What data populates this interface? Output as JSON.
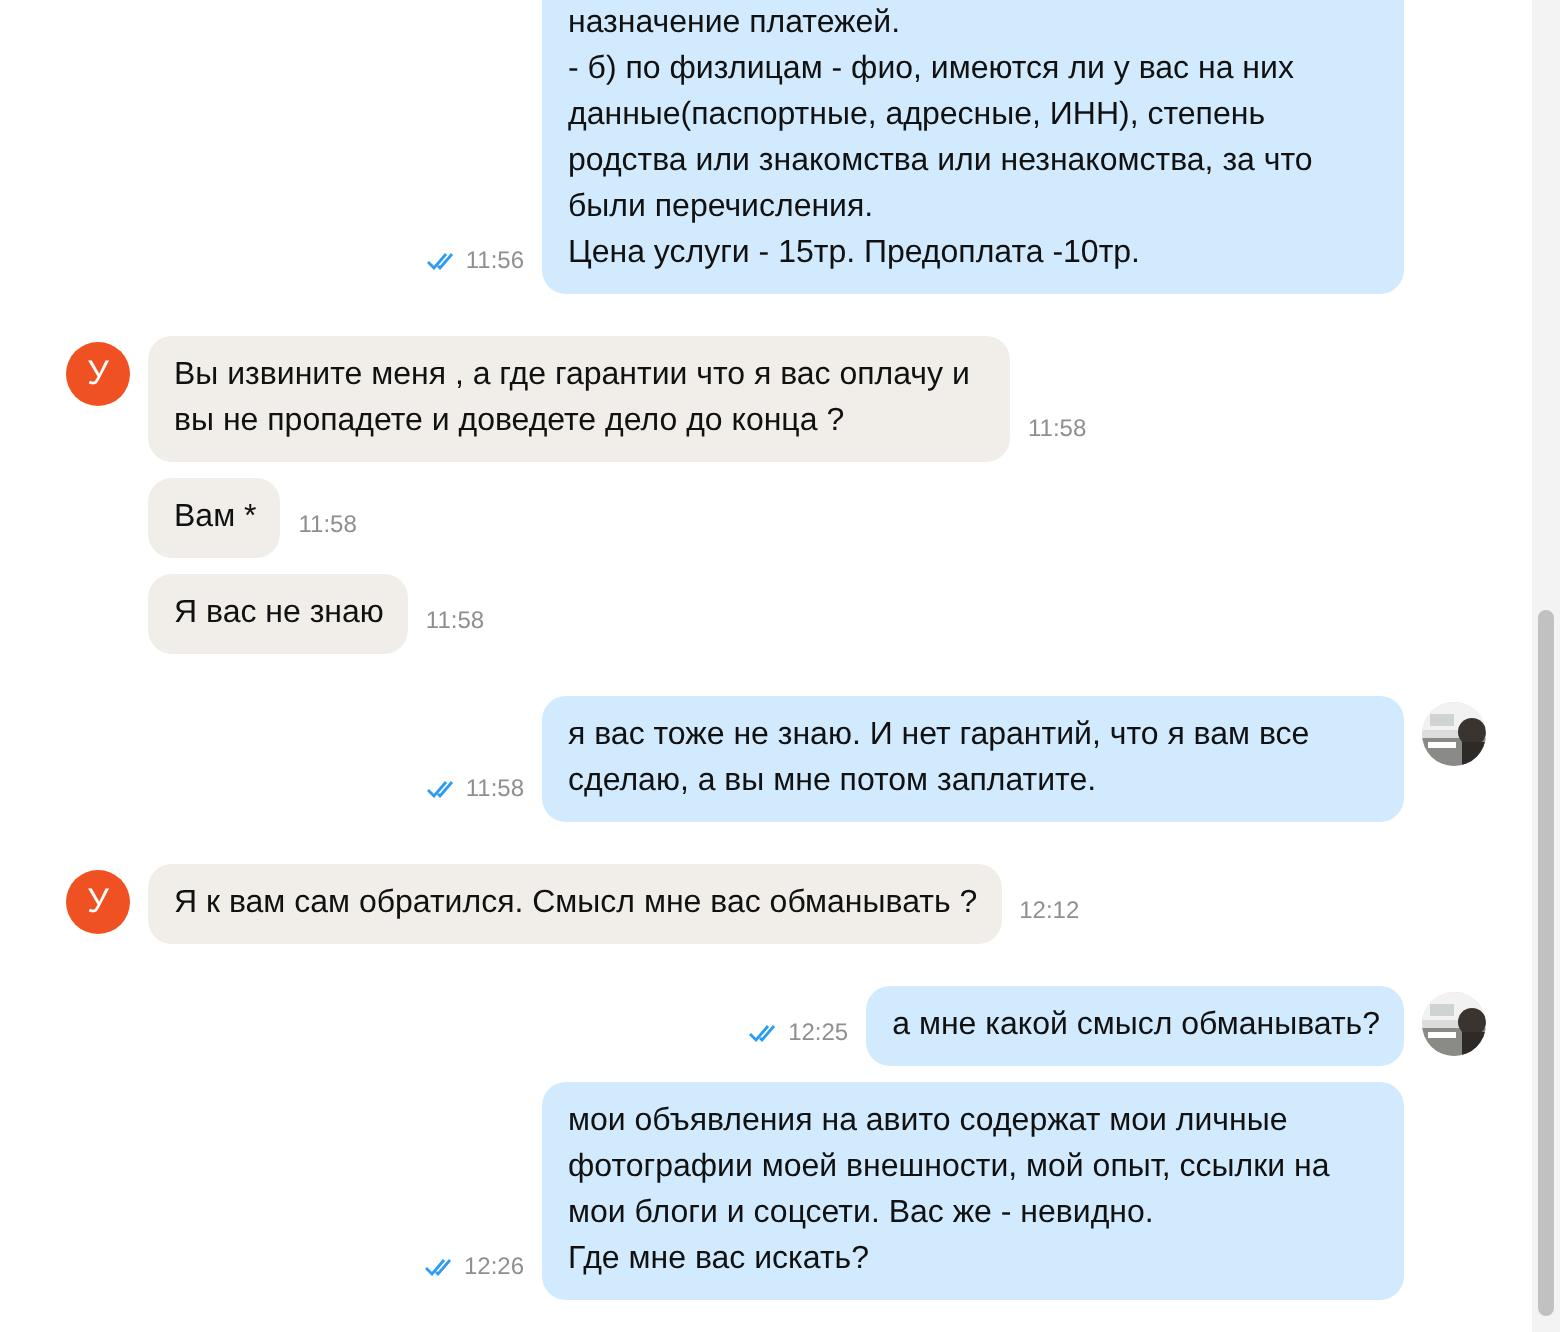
{
  "messages": [
    {
      "kind": "outgoing",
      "text": "назначение платежей.\n- б) по физлицам -  фио, имеются ли у вас на них данные(паспортные, адресные, ИНН), степень родства или знакомства или незнакомства, за что были перечисления.\nЦена услуги - 15тр. Предоплата -10тр.",
      "time": "11:56",
      "read": true
    },
    {
      "kind": "incoming",
      "avatar": {
        "kind": "letter",
        "letter": "У"
      },
      "text": "Вы извините меня , а где гарантии  что я вас оплачу и вы не пропадете и доведете дело до конца ?",
      "time": "11:58"
    },
    {
      "kind": "incoming",
      "text": "Вам *",
      "time": "11:58"
    },
    {
      "kind": "incoming",
      "text": "Я вас не знаю",
      "time": "11:58"
    },
    {
      "kind": "outgoing",
      "text": "я вас тоже не знаю. И нет гарантий, что я вам все сделаю, а вы мне потом заплатите.",
      "time": "11:58",
      "read": true
    },
    {
      "kind": "incoming",
      "avatar": {
        "kind": "letter",
        "letter": "У"
      },
      "text": "Я к вам сам обратился. Смысл мне вас обманывать ?",
      "time": "12:12"
    },
    {
      "kind": "outgoing",
      "text": "а мне какой смысл обманывать?",
      "time": "12:25",
      "read": true
    },
    {
      "kind": "outgoing",
      "text": "мои объявления на авито содержат мои личные фотографии моей внешности, мой опыт, ссылки на мои блоги и соцсети. Вас же - невидно.\nГде мне вас искать?",
      "time": "12:26",
      "read": true
    }
  ]
}
